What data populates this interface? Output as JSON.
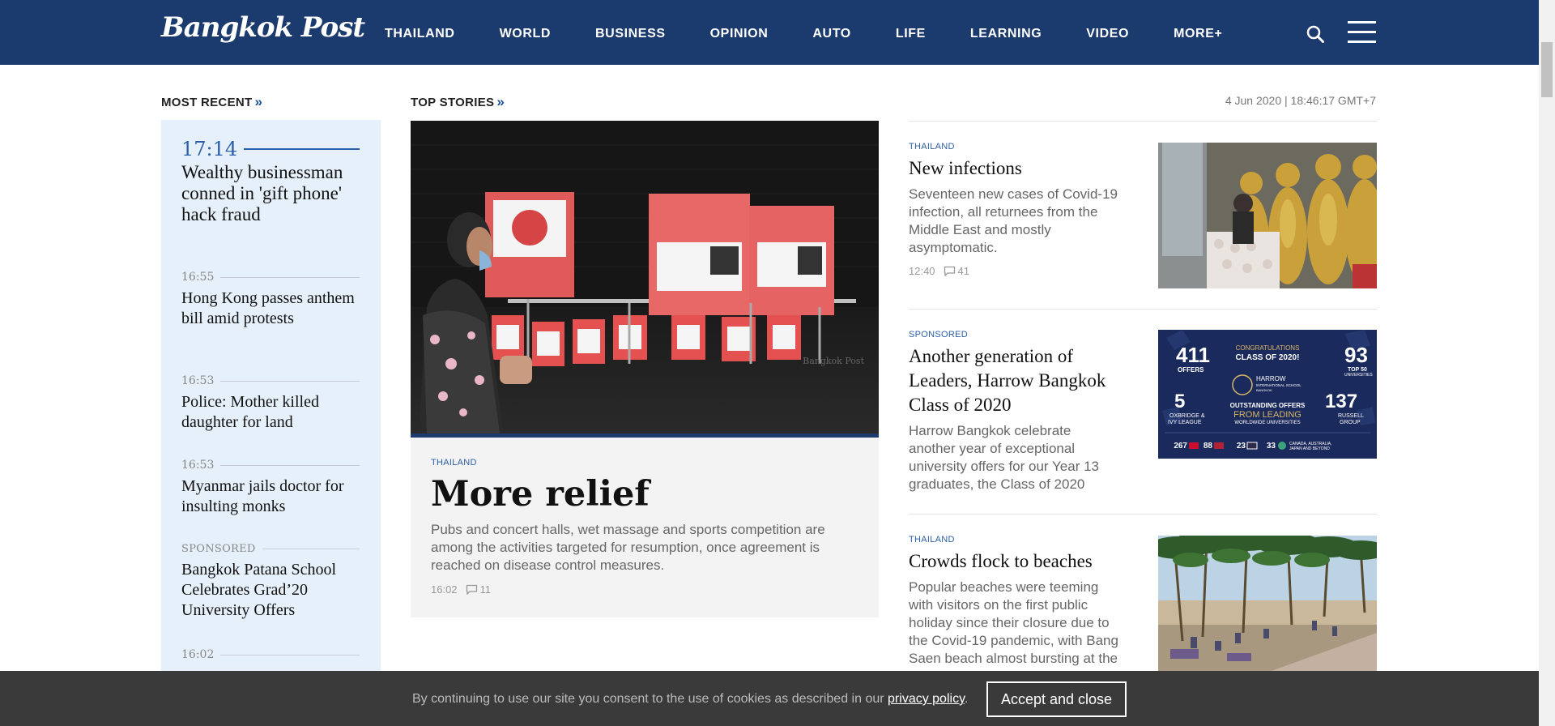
{
  "header": {
    "logo": "Bangkok Post",
    "nav": [
      "THAILAND",
      "WORLD",
      "BUSINESS",
      "OPINION",
      "AUTO",
      "LIFE",
      "LEARNING",
      "VIDEO",
      "MORE+"
    ],
    "search_icon": "search-icon",
    "menu_icon": "hamburger-menu-icon",
    "bg_color": "#1b3a6e"
  },
  "most_recent": {
    "heading": "MOST RECENT",
    "chevron": "»",
    "items": [
      {
        "time": "17:14",
        "title": "Wealthy businessman conned in 'gift phone' hack fraud"
      },
      {
        "time": "16:55",
        "title": "Hong Kong passes anthem bill amid protests"
      },
      {
        "time": "16:53",
        "title": "Police: Mother killed daughter for land"
      },
      {
        "time": "16:53",
        "title": "Myanmar jails doctor for insulting monks"
      },
      {
        "time": "SPONSORED",
        "title": "Bangkok Patana School Celebrates Grad’20 University Offers"
      },
      {
        "time": "16:02",
        "title": ""
      }
    ]
  },
  "top_stories": {
    "heading": "TOP STORIES",
    "chevron": "»",
    "date": "4 Jun 2020 | 18:46:17 GMT+7",
    "lead": {
      "category": "THAILAND",
      "headline": "More relief",
      "summary": "Pubs and concert halls, wet massage and sports competition are among the activities targeted for resumption, once agreement is reached on disease control measures.",
      "time": "16:02",
      "comments": "11"
    },
    "stories": [
      {
        "category": "THAILAND",
        "headline": "New infections",
        "summary": "Seventeen new cases of Covid-19 infection, all returnees from the Middle East and mostly asymptomatic.",
        "time": "12:40",
        "comments": "41"
      },
      {
        "category": "SPONSORED",
        "headline": "Another generation of Leaders, Harrow Bangkok Class of 2020",
        "summary": "Harrow Bangkok celebrate another year of exceptional university offers for our Year 13 graduates, the Class of 2020"
      },
      {
        "category": "THAILAND",
        "headline": "Crowds flock to beaches",
        "summary": "Popular beaches were teeming with visitors on the first public holiday since their closure due to the Covid-19 pandemic, with Bang Saen beach almost bursting at the"
      }
    ],
    "ad": {
      "offers": "411",
      "offers_lbl": "OFFERS",
      "congrats": "CONGRATULATIONS",
      "class": "CLASS OF 2020!",
      "top50": "93",
      "top50_lbl": "TOP 50",
      "top50_sub": "UNIVERSITIES",
      "harrow": "HARROW",
      "school": "INTERNATIONAL SCHOOL",
      "city": "BANGKOK",
      "oxb": "5",
      "oxb_lbl": "OXBRIDGE &",
      "oxb_lbl2": "IVY LEAGUE",
      "outstanding": "OUTSTANDING OFFERS",
      "from_leading": "FROM LEADING",
      "worldwide": "WORLDWIDE UNIVERSITIES",
      "russell": "137",
      "russell_lbl": "RUSSELL",
      "russell_lbl2": "GROUP",
      "uk": "267",
      "us": "88",
      "th": "23",
      "other": "33",
      "other_lbl": "CANADA, AUSTRALIA,",
      "other_lbl2": "JAPAN AND BEYOND"
    }
  },
  "cookie": {
    "text": "By continuing to use our site you consent to the use of cookies as described in our",
    "link": "privacy policy",
    "period": ".",
    "button": "Accept and close"
  }
}
